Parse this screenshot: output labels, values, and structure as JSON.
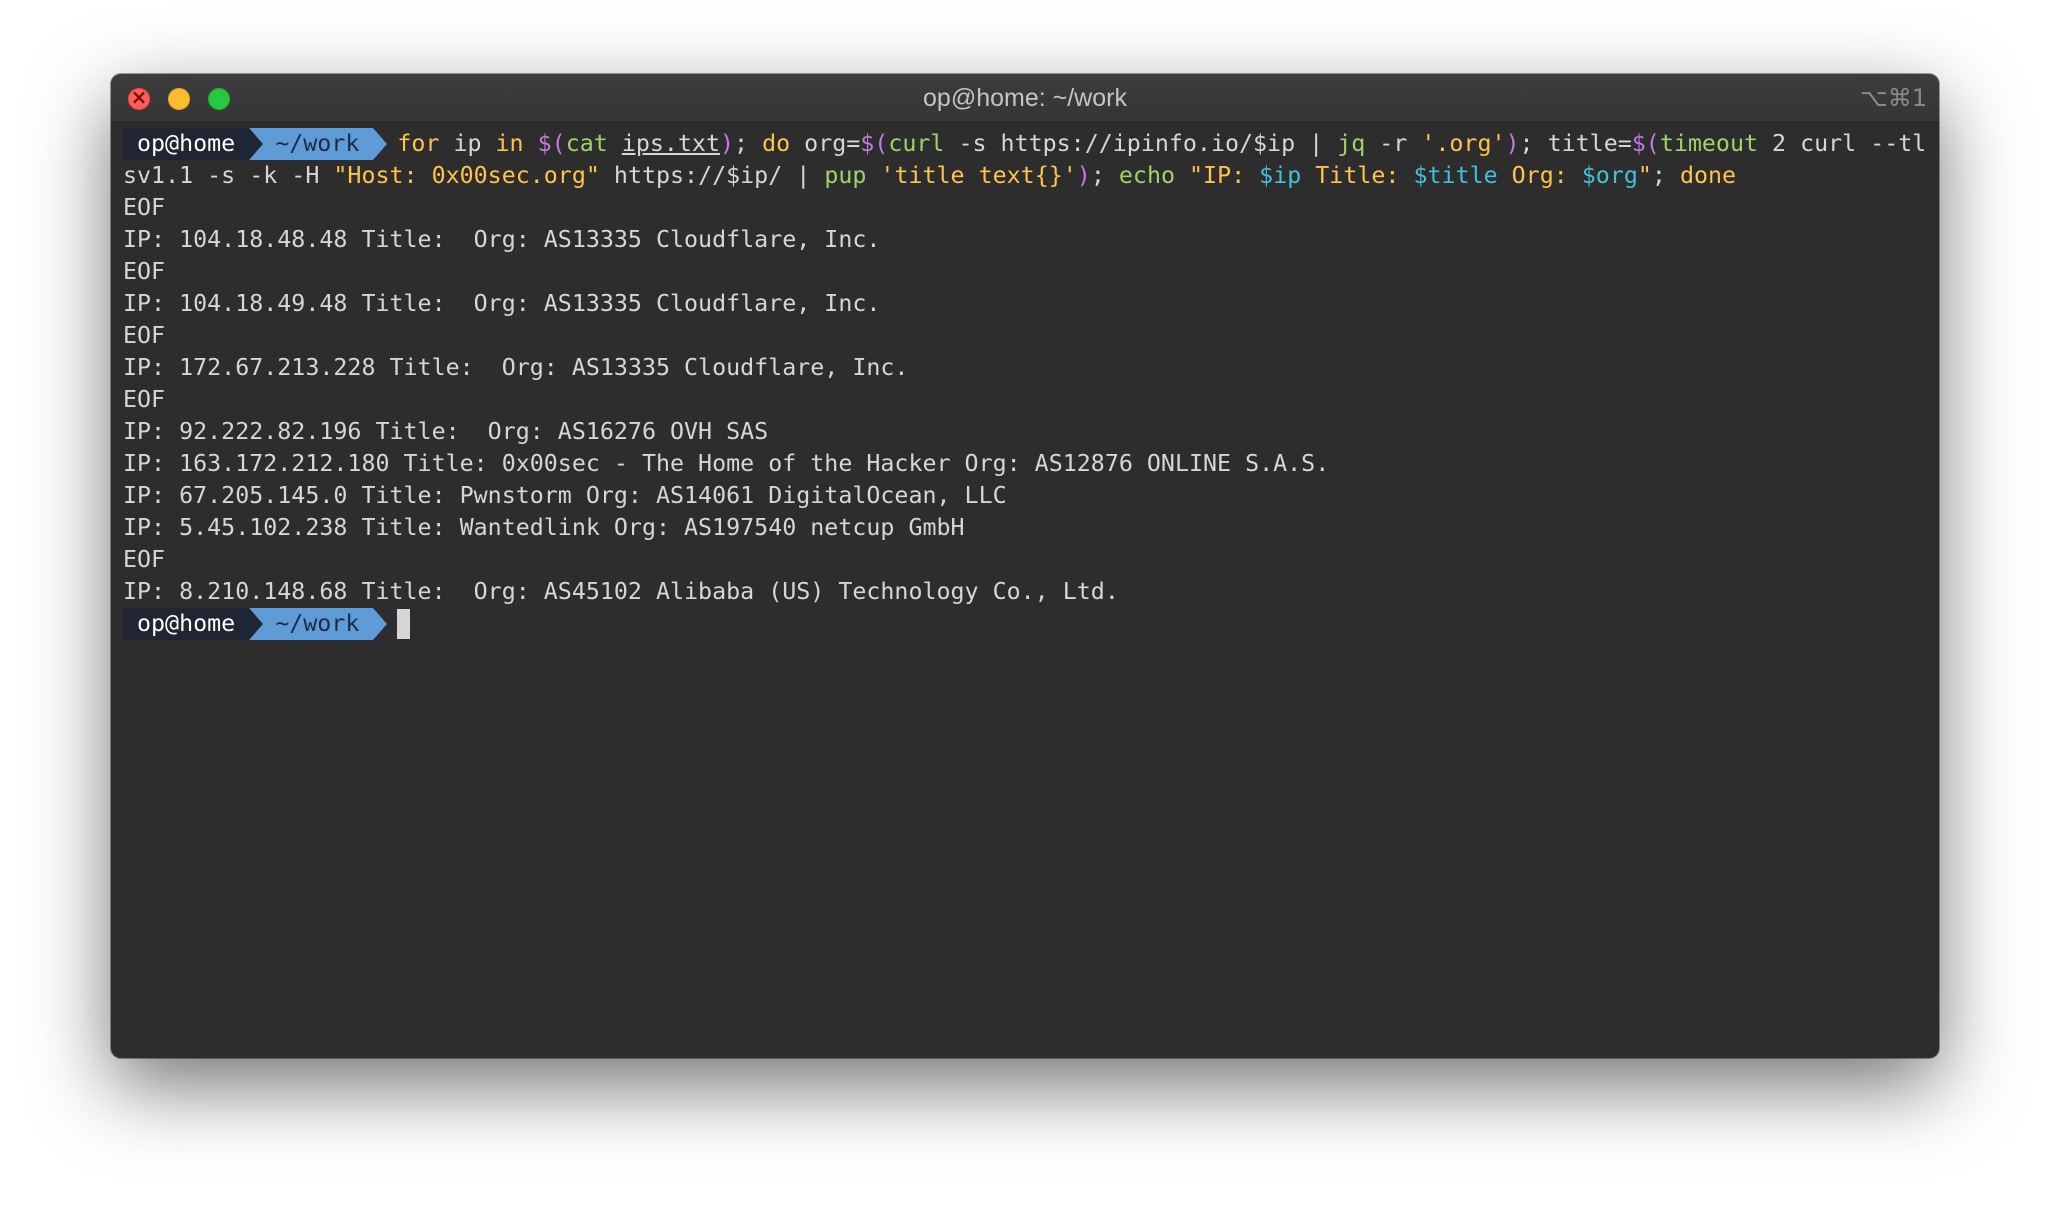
{
  "window": {
    "title": "op@home: ~/work",
    "shortcut": "⌥⌘1"
  },
  "prompt": {
    "user": "op@home",
    "dir": "~/work"
  },
  "command": {
    "line1": [
      {
        "t": "for",
        "c": "kw"
      },
      {
        "t": " ip ",
        "c": ""
      },
      {
        "t": "in",
        "c": "kw"
      },
      {
        "t": " ",
        "c": ""
      },
      {
        "t": "$(",
        "c": "sub"
      },
      {
        "t": "cat",
        "c": "tool"
      },
      {
        "t": " ",
        "c": ""
      },
      {
        "t": "ips.txt",
        "c": "u"
      },
      {
        "t": ")",
        "c": "sub"
      },
      {
        "t": "; ",
        "c": ""
      },
      {
        "t": "do",
        "c": "kw"
      },
      {
        "t": " org=",
        "c": ""
      },
      {
        "t": "$(",
        "c": "sub"
      },
      {
        "t": "curl",
        "c": "tool"
      },
      {
        "t": " -s https://ipinfo.io/$ip | ",
        "c": ""
      },
      {
        "t": "jq",
        "c": "tool"
      },
      {
        "t": " -r ",
        "c": ""
      },
      {
        "t": "'.org'",
        "c": "str"
      },
      {
        "t": ")",
        "c": "sub"
      },
      {
        "t": "; title=",
        "c": ""
      },
      {
        "t": "$(",
        "c": "sub"
      },
      {
        "t": "timeout",
        "c": "tool"
      },
      {
        "t": " 2 curl --tl",
        "c": ""
      }
    ],
    "line2": [
      {
        "t": "sv1.1 -s -k -H ",
        "c": ""
      },
      {
        "t": "\"Host: 0x00sec.org\"",
        "c": "str"
      },
      {
        "t": " https://$ip/ | ",
        "c": ""
      },
      {
        "t": "pup",
        "c": "tool"
      },
      {
        "t": " ",
        "c": ""
      },
      {
        "t": "'title text{}'",
        "c": "str"
      },
      {
        "t": ")",
        "c": "sub"
      },
      {
        "t": "; ",
        "c": ""
      },
      {
        "t": "echo",
        "c": "tool"
      },
      {
        "t": " ",
        "c": ""
      },
      {
        "t": "\"IP: ",
        "c": "str"
      },
      {
        "t": "$ip",
        "c": "var"
      },
      {
        "t": " Title: ",
        "c": "str"
      },
      {
        "t": "$title",
        "c": "var"
      },
      {
        "t": " Org: ",
        "c": "str"
      },
      {
        "t": "$org",
        "c": "var"
      },
      {
        "t": "\"",
        "c": "str"
      },
      {
        "t": "; ",
        "c": ""
      },
      {
        "t": "done",
        "c": "kw"
      }
    ]
  },
  "output": [
    "EOF",
    "IP: 104.18.48.48 Title:  Org: AS13335 Cloudflare, Inc.",
    "EOF",
    "IP: 104.18.49.48 Title:  Org: AS13335 Cloudflare, Inc.",
    "EOF",
    "IP: 172.67.213.228 Title:  Org: AS13335 Cloudflare, Inc.",
    "EOF",
    "IP: 92.222.82.196 Title:  Org: AS16276 OVH SAS",
    "IP: 163.172.212.180 Title: 0x00sec - The Home of the Hacker Org: AS12876 ONLINE S.A.S.",
    "IP: 67.205.145.0 Title: Pwnstorm Org: AS14061 DigitalOcean, LLC",
    "IP: 5.45.102.238 Title: Wantedlink Org: AS197540 netcup GmbH",
    "EOF",
    "IP: 8.210.148.68 Title:  Org: AS45102 Alibaba (US) Technology Co., Ltd."
  ],
  "colors": {
    "background": "#2d2d2d",
    "keyword": "#ffc24b",
    "command": "#9ed36a",
    "variable": "#43c0d9",
    "substitution": "#c679dd",
    "prompt_dir_bg": "#5f9bd6"
  }
}
